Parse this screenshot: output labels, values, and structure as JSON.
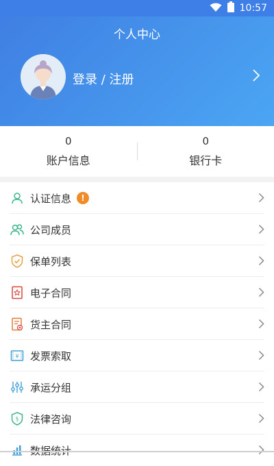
{
  "status_bar": {
    "time": "10:57"
  },
  "header": {
    "title": "个人中心",
    "login_text": "登录 / 注册"
  },
  "stats": [
    {
      "value": "0",
      "label": "账户信息"
    },
    {
      "value": "0",
      "label": "银行卡"
    }
  ],
  "menu": {
    "items": [
      {
        "label": "认证信息",
        "icon": "user-icon",
        "badge": "!"
      },
      {
        "label": "公司成员",
        "icon": "users-icon"
      },
      {
        "label": "保单列表",
        "icon": "shield-check-icon"
      },
      {
        "label": "电子合同",
        "icon": "contract-icon"
      },
      {
        "label": "货主合同",
        "icon": "shipper-contract-icon"
      },
      {
        "label": "发票索取",
        "icon": "invoice-icon"
      },
      {
        "label": "承运分组",
        "icon": "sliders-icon"
      },
      {
        "label": "法律咨询",
        "icon": "law-shield-icon"
      },
      {
        "label": "数据统计",
        "icon": "stats-icon"
      }
    ]
  },
  "colors": {
    "header_start": "#3f7fe3",
    "header_end": "#4ba6f3",
    "badge": "#f08c28",
    "icon_green": "#3cb48c",
    "icon_orange": "#e8a040",
    "icon_red": "#d9463a",
    "icon_blue": "#3fa0d8"
  }
}
